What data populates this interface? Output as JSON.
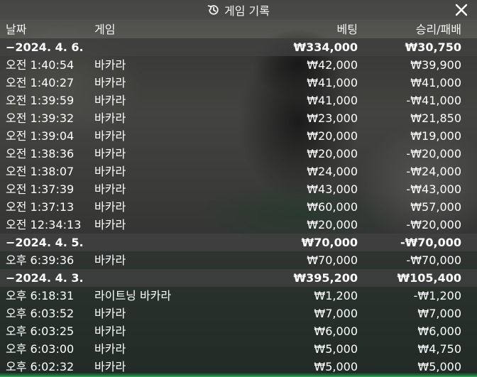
{
  "title": "게임 기록",
  "icons": {
    "history": "history-icon",
    "close": "close-icon"
  },
  "columns": {
    "date": "날짜",
    "game": "게임",
    "bet": "베팅",
    "win_loss": "승리/패배"
  },
  "rows": [
    {
      "type": "group",
      "date": "−2024. 4. 6.",
      "game": "",
      "bet": "₩334,000",
      "win": "₩30,750"
    },
    {
      "type": "entry",
      "date": "오전 1:40:54",
      "game": "바카라",
      "bet": "₩42,000",
      "win": "₩39,900"
    },
    {
      "type": "entry",
      "date": "오전 1:40:27",
      "game": "바카라",
      "bet": "₩41,000",
      "win": "₩41,000"
    },
    {
      "type": "entry",
      "date": "오전 1:39:59",
      "game": "바카라",
      "bet": "₩41,000",
      "win": "-₩41,000"
    },
    {
      "type": "entry",
      "date": "오전 1:39:32",
      "game": "바카라",
      "bet": "₩23,000",
      "win": "₩21,850"
    },
    {
      "type": "entry",
      "date": "오전 1:39:04",
      "game": "바카라",
      "bet": "₩20,000",
      "win": "₩19,000"
    },
    {
      "type": "entry",
      "date": "오전 1:38:36",
      "game": "바카라",
      "bet": "₩20,000",
      "win": "-₩20,000"
    },
    {
      "type": "entry",
      "date": "오전 1:38:07",
      "game": "바카라",
      "bet": "₩24,000",
      "win": "-₩24,000"
    },
    {
      "type": "entry",
      "date": "오전 1:37:39",
      "game": "바카라",
      "bet": "₩43,000",
      "win": "-₩43,000"
    },
    {
      "type": "entry",
      "date": "오전 1:37:13",
      "game": "바카라",
      "bet": "₩60,000",
      "win": "₩57,000"
    },
    {
      "type": "entry",
      "date": "오전 12:34:13",
      "game": "바카라",
      "bet": "₩20,000",
      "win": "-₩20,000"
    },
    {
      "type": "group",
      "date": "−2024. 4. 5.",
      "game": "",
      "bet": "₩70,000",
      "win": "-₩70,000"
    },
    {
      "type": "entry",
      "date": "오후 6:39:36",
      "game": "바카라",
      "bet": "₩70,000",
      "win": "-₩70,000"
    },
    {
      "type": "group",
      "date": "−2024. 4. 3.",
      "game": "",
      "bet": "₩395,200",
      "win": "₩105,400"
    },
    {
      "type": "entry",
      "date": "오후 6:18:31",
      "game": "라이트닝 바카라",
      "bet": "₩1,200",
      "win": "-₩1,200"
    },
    {
      "type": "entry",
      "date": "오후 6:03:52",
      "game": "바카라",
      "bet": "₩7,000",
      "win": "₩7,000"
    },
    {
      "type": "entry",
      "date": "오후 6:03:25",
      "game": "바카라",
      "bet": "₩6,000",
      "win": "₩6,000"
    },
    {
      "type": "entry",
      "date": "오후 6:03:00",
      "game": "바카라",
      "bet": "₩5,000",
      "win": "₩4,750"
    },
    {
      "type": "entry",
      "date": "오후 6:02:32",
      "game": "바카라",
      "bet": "₩5,000",
      "win": "₩5,000"
    }
  ]
}
